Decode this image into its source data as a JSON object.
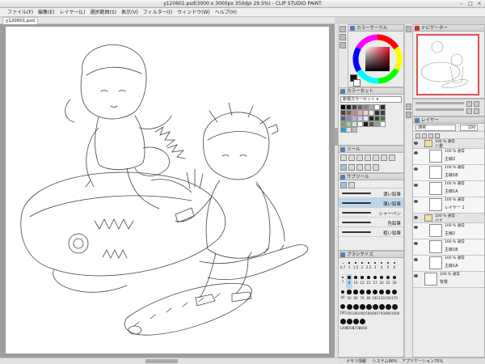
{
  "window": {
    "title": "y120601.psd(3000 x 3000px 350dpi 29.5%) - CLIP STUDIO PAINT"
  },
  "menu": [
    "ファイル(F)",
    "編集(E)",
    "レイヤー(L)",
    "選択範囲(S)",
    "表示(V)",
    "フィルター(I)",
    "ウィンドウ(W)",
    "ヘルプ(H)"
  ],
  "document": {
    "tab": "y120601.psd"
  },
  "color_circle": {
    "title": "カラーサークル",
    "main_color": "#d41c2c"
  },
  "color_set": {
    "title": "カラーセット",
    "selected": "新規カラーセット",
    "swatches": [
      "#000000",
      "#222222",
      "#444444",
      "#666666",
      "#888888",
      "#aaaaaa",
      "#ffffff",
      "#3a2a2a",
      "#5a3a3a",
      "#8a5a5a",
      "#c08a8a",
      "#e0b0b0",
      "#f0d0d0",
      "#ffe8e8",
      "#2a2a3a",
      "#3a3a5a",
      "#5a5a8a",
      "#8a8ac0",
      "#b0b0e0",
      "#d0d0f0",
      "#e8e8ff",
      "#1a2a1a",
      "#2a4a2a",
      "#4a7a4a",
      "#7aa07a",
      "#a0d0a0",
      "#d0e8d0",
      "#ffffff",
      "#1a1a1a",
      "#555555",
      "#999999",
      "#ffffff",
      "#1ca0e0",
      "#e0e0e0",
      "#c0c0c0"
    ]
  },
  "tool": {
    "title": "ツール"
  },
  "subtool": {
    "title": "サブツール",
    "brushes": [
      {
        "label": "濃い鉛筆",
        "selected": false
      },
      {
        "label": "薄い鉛筆",
        "selected": true
      },
      {
        "label": "シャーペン",
        "selected": false
      },
      {
        "label": "色鉛筆",
        "selected": false
      },
      {
        "label": "粗い鉛筆",
        "selected": false
      }
    ]
  },
  "brush_size": {
    "title": "ブラシサイズ",
    "labels": [
      "0.7",
      "1",
      "1.5",
      "2",
      "2.5",
      "3",
      "4",
      "5",
      "6",
      "7",
      "8",
      "10",
      "12",
      "15",
      "17",
      "20",
      "25",
      "30",
      "40",
      "50",
      "60",
      "70",
      "80",
      "100",
      "120",
      "150",
      "170",
      "200",
      "250",
      "300",
      "400",
      "500",
      "600",
      "700",
      "800",
      "1000",
      "1200",
      "1500",
      "1700",
      "2000"
    ]
  },
  "navigator": {
    "title": "ナビゲーター"
  },
  "layer_panel": {
    "title": "レイヤー",
    "blend": "通常",
    "opacity": "100",
    "layers": [
      {
        "pct": "100 % 通常",
        "name": "八重",
        "folder": true,
        "indent": 0
      },
      {
        "pct": "100 % 通常",
        "name": "主線2",
        "folder": false,
        "indent": 1
      },
      {
        "pct": "100 % 通常",
        "name": "主線1B",
        "folder": false,
        "indent": 1
      },
      {
        "pct": "100 % 通常",
        "name": "主線1A",
        "folder": false,
        "indent": 1
      },
      {
        "pct": "100 % 通常",
        "name": "レイヤー 1",
        "folder": false,
        "indent": 1
      },
      {
        "pct": "100 % 通常",
        "name": "バイ",
        "folder": true,
        "indent": 0
      },
      {
        "pct": "100 % 通常",
        "name": "主線2",
        "folder": false,
        "indent": 1
      },
      {
        "pct": "100 % 通常",
        "name": "主線1B",
        "folder": false,
        "indent": 1
      },
      {
        "pct": "100 % 通常",
        "name": "主線1A",
        "folder": false,
        "indent": 1
      },
      {
        "pct": "100 % 通常",
        "name": "背景",
        "folder": false,
        "indent": 0
      }
    ]
  },
  "status": {
    "memory": "メモリ情報",
    "system": "システム66%",
    "application": "アプリケーション75%"
  }
}
